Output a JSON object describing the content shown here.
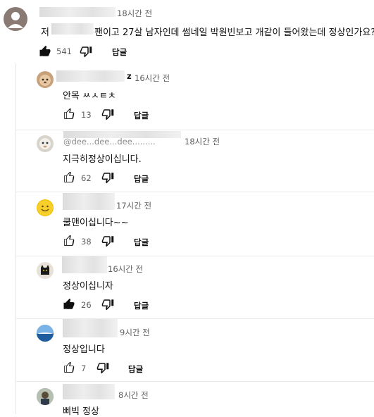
{
  "top_comment": {
    "time": "18시간 전",
    "text_prefix": "저",
    "text_rest": "팬이고 27살 남자인데 썸네일 박원빈보고 개같이 들어왔는데 정상인가요?",
    "likes": "541",
    "reply_label": "답글"
  },
  "replies": [
    {
      "handle_suffix": "z",
      "time": "16시간 전",
      "text": "안목 ㅆㅅㅌㅊ",
      "likes": "13",
      "reply_label": "답글",
      "liked": false
    },
    {
      "handle": "@dee...dee...dee......... ",
      "time": "18시간 전",
      "text": "지극히정상이십니다.",
      "likes": "62",
      "reply_label": "답글",
      "liked": false
    },
    {
      "time": "17시간 전",
      "text": "쿨맨이십니다~~",
      "likes": "38",
      "reply_label": "답글",
      "liked": false
    },
    {
      "time": "16시간 전",
      "text": "정상이십니자",
      "likes": "26",
      "reply_label": "답글",
      "liked": true
    },
    {
      "time": "9시간 전",
      "text": "정상입니다",
      "likes": "7",
      "reply_label": "답글",
      "liked": false
    },
    {
      "time": "8시간 전",
      "text": "삐빅 정상"
    }
  ],
  "colors": {
    "meta": "#606060",
    "text": "#0f0f0f",
    "divider": "#e8e8e8"
  }
}
